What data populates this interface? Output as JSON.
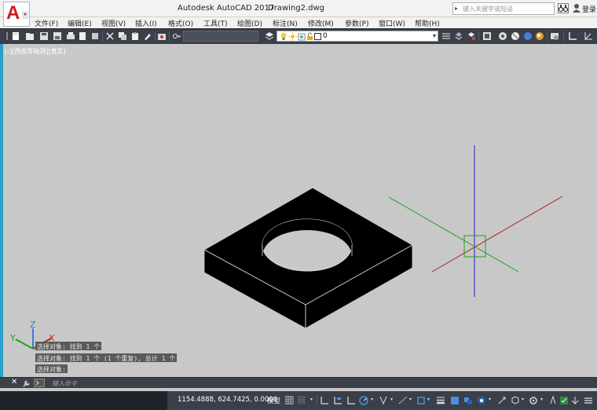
{
  "titlebar": {
    "app_title": "Autodesk AutoCAD 2017",
    "file_name": "Drawing2.dwg",
    "search_placeholder": "键入关键字或短语",
    "login_label": "登录",
    "logo_letter": "A"
  },
  "menu": {
    "items": [
      "文件(F)",
      "编辑(E)",
      "视图(V)",
      "插入(I)",
      "格式(O)",
      "工具(T)",
      "绘图(D)",
      "标注(N)",
      "修改(M)",
      "参数(P)",
      "窗口(W)",
      "帮助(H)"
    ]
  },
  "toolbar": {
    "layer_name": "0"
  },
  "viewport": {
    "view_label": "[-][西南等轴测][真实]",
    "axis_labels": {
      "z": "Z",
      "y": "Y",
      "x": "X"
    }
  },
  "command_history": [
    "选择对象: 找到 1 个",
    "选择对象: 找到 1 个 (1 个重复), 总计 1 个",
    "选择对象:"
  ],
  "command_input": {
    "placeholder": "键入命令"
  },
  "statusbar": {
    "coordinates": "1154.4888, 624.7425, 0.0000",
    "model_label": "模型"
  },
  "colors": {
    "toolbar_bg": "#3a3f49",
    "viewport_bg": "#c8c8c8",
    "logo_red": "#d01818",
    "axis_blue": "#2020c8",
    "axis_red": "#b02020",
    "axis_green": "#20a020"
  },
  "icons": {
    "title": [
      "app-logo-icon",
      "binoculars-icon",
      "user-icon"
    ],
    "toolbar": [
      "new-icon",
      "open-icon",
      "save-icon",
      "saveas-icon",
      "plot-icon",
      "undo-icon",
      "redo-icon",
      "match-icon",
      "layer-icon",
      "lightbulb-icon",
      "sun-icon",
      "lock-icon"
    ],
    "status": [
      "grid-icon",
      "snap-icon",
      "ortho-icon",
      "polar-icon",
      "osnap-icon",
      "otrack-icon",
      "lineweight-icon",
      "annotation-icon",
      "workspace-icon",
      "settings-icon",
      "fullscreen-icon"
    ]
  }
}
